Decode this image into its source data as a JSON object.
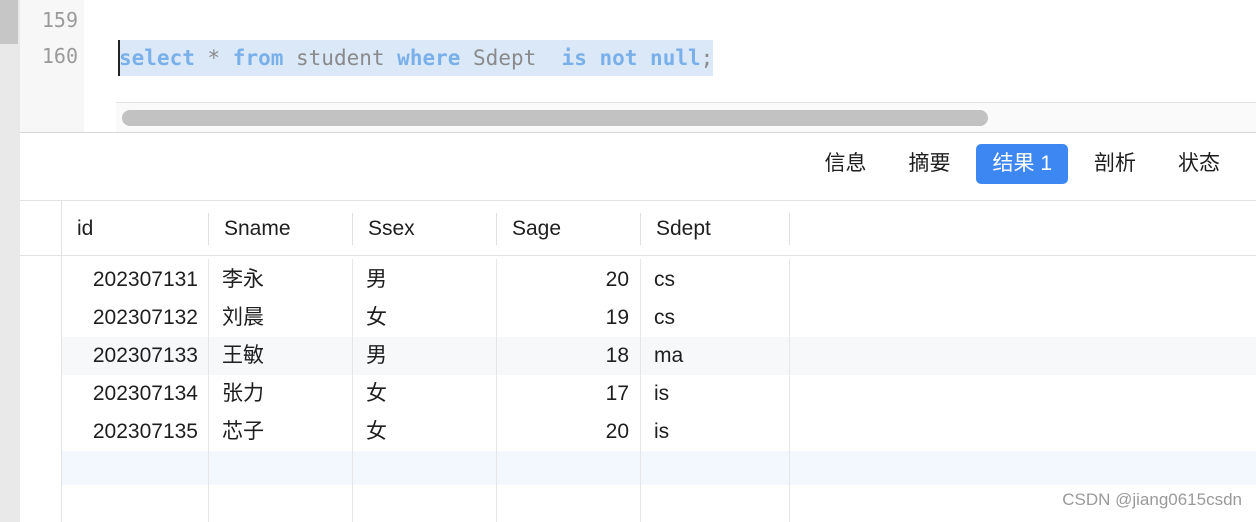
{
  "editor": {
    "line_numbers": [
      "159",
      "160"
    ],
    "code": {
      "kw_select": "select",
      "star": " * ",
      "kw_from": "from",
      "table": " student ",
      "kw_where": "where",
      "column": " Sdept  ",
      "kw_is_not_null": "is not null",
      "semicolon": ";"
    }
  },
  "tabs": [
    "信息",
    "摘要",
    "结果 1",
    "剖析",
    "状态"
  ],
  "active_tab_index": 2,
  "grid": {
    "columns": [
      "id",
      "Sname",
      "Ssex",
      "Sage",
      "Sdept"
    ],
    "rows": [
      [
        "202307131",
        "李永",
        "男",
        "20",
        "cs"
      ],
      [
        "202307132",
        "刘晨",
        "女",
        "19",
        "cs"
      ],
      [
        "202307133",
        "王敏",
        "男",
        "18",
        "ma"
      ],
      [
        "202307134",
        "张力",
        "女",
        "17",
        "is"
      ],
      [
        "202307135",
        "芯子",
        "女",
        "20",
        "is"
      ]
    ]
  },
  "watermark": "CSDN @jiang0615csdn"
}
